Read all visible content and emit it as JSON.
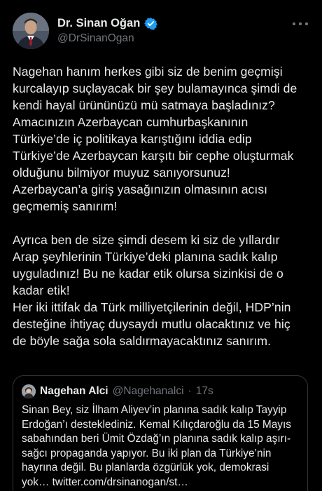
{
  "author": {
    "name": "Dr. Sinan Oğan",
    "handle": "@DrSinanOgan",
    "verified": true,
    "verified_color": "#1d9bf0"
  },
  "menu_icon": "more-horizontal-icon",
  "tweet_lines": [
    "Nagehan hanım herkes gibi siz de benim geçmişi",
    "kurcalayıp suçlayacak bir şey bulamayınca şimdi de",
    "kendi hayal ürününüzü mü satmaya başladınız?",
    "Amacınızın Azerbaycan cumhurbaşkanının",
    "Türkiye’de iç politikaya karıştığını iddia edip",
    "Türkiye’de Azerbaycan karşıtı bir cephe oluşturmak",
    "olduğunu bilmiyor muyuz sanıyorsunuz!",
    "Azerbaycan’a giriş yasağınızın olmasının acısı",
    "geçmemiş sanırım!",
    "",
    "Ayrıca ben de size şimdi desem ki siz de yıllardır",
    "Arap şeyhlerinin Türkiye’deki planına sadık kalıp",
    "uyguladınız! Bu ne kadar etik olursa sizinkisi de o",
    "kadar etik!",
    "Her iki ittifak da Türk milliyetçilerinin değil, HDP’nin",
    "desteğine ihtiyaç duysaydı mutlu olacaktınız ve hiç",
    "de böyle sağa sola saldırmayacaktınız sanırım."
  ],
  "quote": {
    "name": "Nagehan Alci",
    "handle": "@Nagehanalci",
    "separator": "·",
    "time": "17s",
    "lines": [
      "Sinan Bey, siz İlham Aliyev’in planına sadık kalıp Tayyip",
      "Erdoğan’ı desteklediniz. Kemal Kılıçdaroğlu da 15 Mayıs",
      "sabahından beri Ümit Özdağ’ın planına sadık kalıp aşırı-",
      "sağcı propaganda yapıyor. Bu iki plan da Türkiye’nin",
      "hayrına değil. Bu planlarda özgürlük yok, demokrasi",
      "yok… twitter.com/drsinanogan/st…"
    ]
  }
}
